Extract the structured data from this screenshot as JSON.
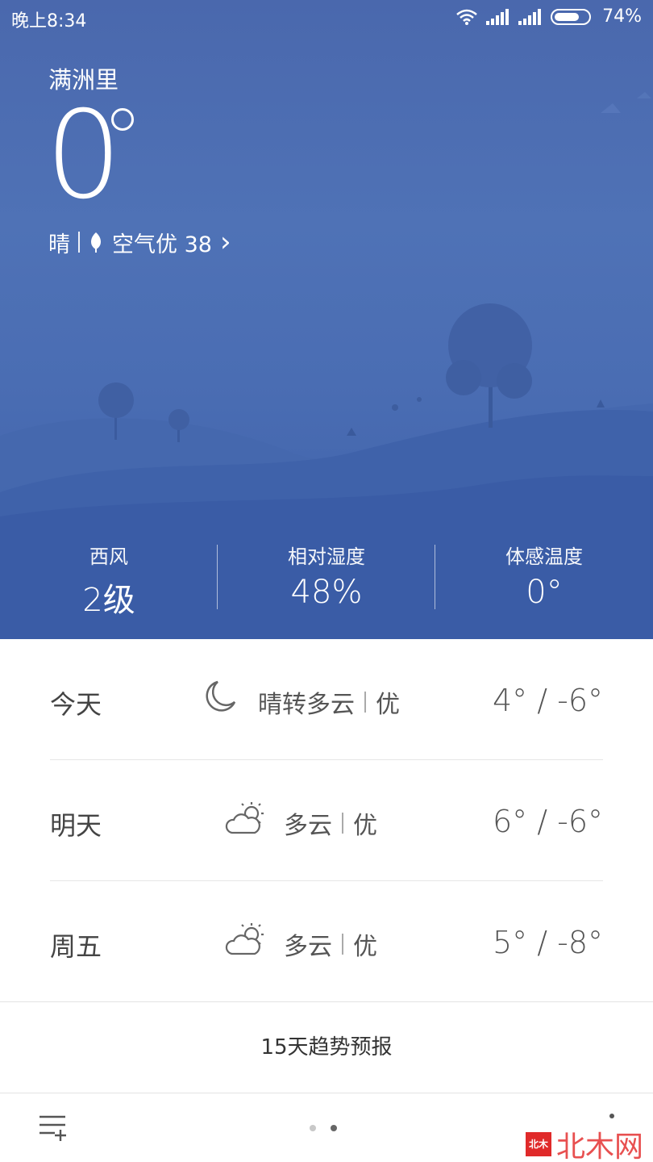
{
  "status_bar": {
    "time": "晚上8:34",
    "battery": "74%",
    "battery_level": 0.74
  },
  "location": {
    "city": "满洲里"
  },
  "current": {
    "temperature": "0",
    "condition": "晴",
    "air_quality": "空气优 38",
    "chevron": "›"
  },
  "details": [
    {
      "label": "西风",
      "value": "2级"
    },
    {
      "label": "相对湿度",
      "value": "48%"
    },
    {
      "label": "体感温度",
      "value": "0°"
    }
  ],
  "forecast": [
    {
      "day": "今天",
      "icon": "moon-icon",
      "condition": "晴转多云",
      "aqi": "优",
      "range": "4° / -6°"
    },
    {
      "day": "明天",
      "icon": "partly-cloudy-icon",
      "condition": "多云",
      "aqi": "优",
      "range": "6° / -6°"
    },
    {
      "day": "周五",
      "icon": "partly-cloudy-icon",
      "condition": "多云",
      "aqi": "优",
      "range": "5° / -8°"
    }
  ],
  "trend_button": "15天趋势预报",
  "pager": {
    "count": 2,
    "active": 1
  },
  "watermark": {
    "badge": "北木",
    "text": "北木网"
  },
  "colors": {
    "hero_top": "#4a68ad",
    "hero_bottom": "#3d5fa8",
    "text_dark": "#444444"
  }
}
